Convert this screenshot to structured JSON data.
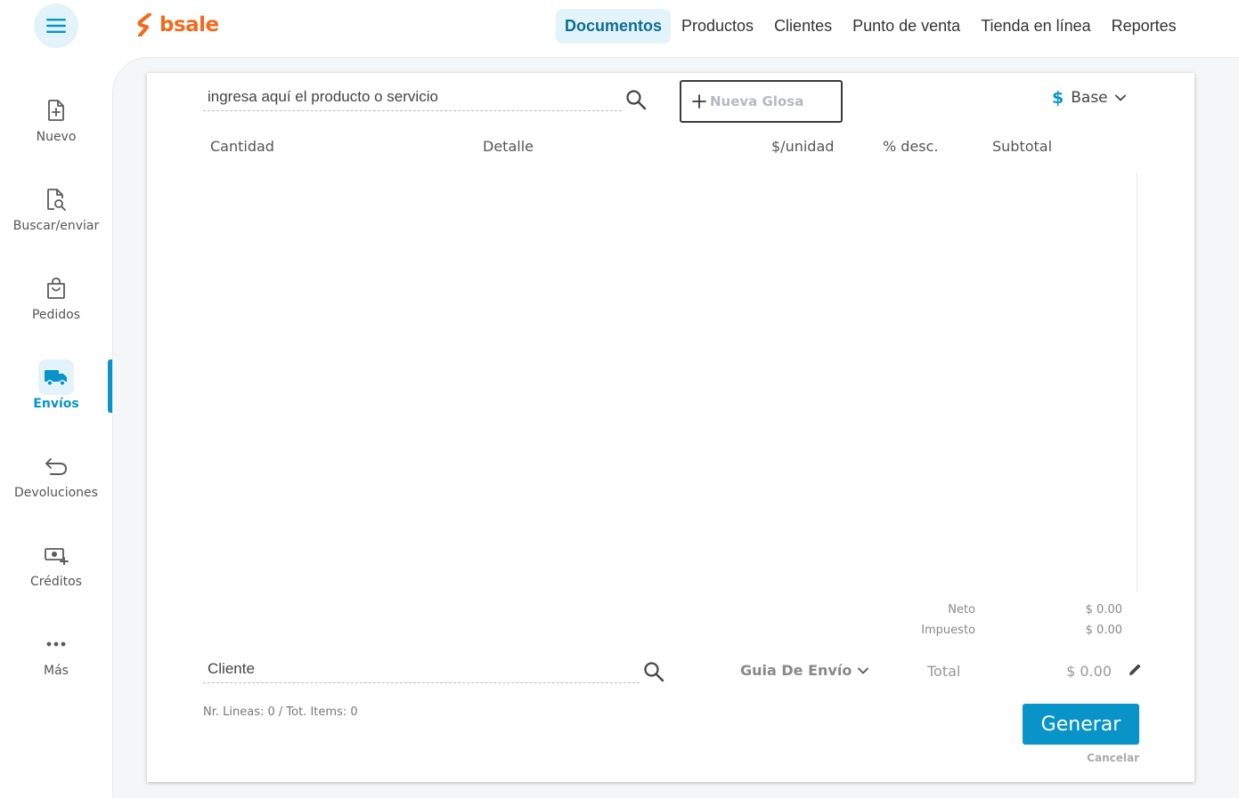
{
  "brand": {
    "name": "bsale",
    "color": "#f26b1d"
  },
  "accent_color": "#0894c8",
  "topnav": [
    {
      "label": "Documentos",
      "active": true
    },
    {
      "label": "Productos",
      "active": false
    },
    {
      "label": "Clientes",
      "active": false
    },
    {
      "label": "Punto de venta",
      "active": false
    },
    {
      "label": "Tienda en línea",
      "active": false
    },
    {
      "label": "Reportes",
      "active": false
    }
  ],
  "sidebar": {
    "items": [
      {
        "label": "Nuevo",
        "icon": "file-plus-icon",
        "active": false
      },
      {
        "label": "Buscar/enviar",
        "icon": "file-search-icon",
        "active": false
      },
      {
        "label": "Pedidos",
        "icon": "shopping-bag-icon",
        "active": false
      },
      {
        "label": "Envíos",
        "icon": "truck-icon",
        "active": true
      },
      {
        "label": "Devoluciones",
        "icon": "return-arrow-icon",
        "active": false
      },
      {
        "label": "Créditos",
        "icon": "money-plus-icon",
        "active": false
      },
      {
        "label": "Más",
        "icon": "more-dots-icon",
        "active": false
      }
    ]
  },
  "editor": {
    "product_search_placeholder": "ingresa aquí el producto o servicio",
    "new_glosa_label": "Nueva Glosa",
    "price_list_symbol": "$",
    "price_list_label": "Base",
    "columns": [
      "Cantidad",
      "Detalle",
      "$/unidad",
      "% desc.",
      "Subtotal"
    ]
  },
  "totals": {
    "neto_label": "Neto",
    "neto_value": "$ 0.00",
    "impuesto_label": "Impuesto",
    "impuesto_value": "$ 0.00",
    "total_label": "Total",
    "total_value": "$ 0.00"
  },
  "client": {
    "search_placeholder": "Cliente",
    "document_type": "Guia De Envío"
  },
  "footer": {
    "line_count": "Nr. Lineas: 0 / Tot. Items: 0",
    "generate_label": "Generar",
    "cancel_label": "Cancelar"
  }
}
